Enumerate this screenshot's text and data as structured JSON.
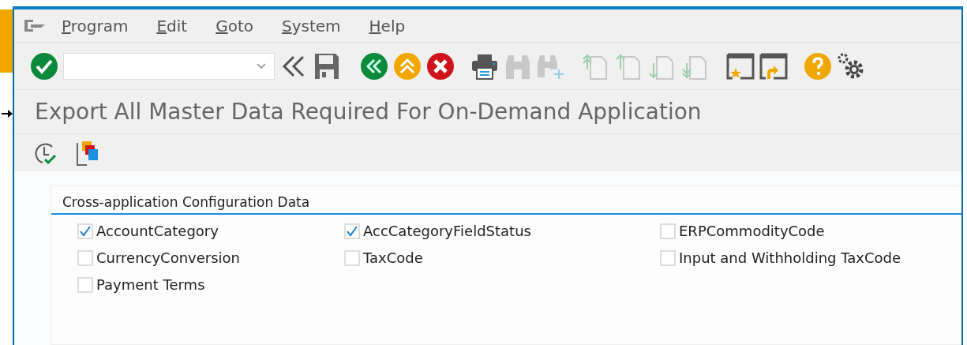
{
  "menu": [
    {
      "label": "Program"
    },
    {
      "label": "Edit"
    },
    {
      "label": "Goto"
    },
    {
      "label": "System"
    },
    {
      "label": "Help"
    }
  ],
  "toolbar": [
    {
      "kind": "enter",
      "disabled": false
    },
    {
      "kind": "command-field",
      "disabled": false
    },
    {
      "kind": "collapse",
      "disabled": false
    },
    {
      "kind": "save",
      "disabled": false
    },
    {
      "kind": "back",
      "disabled": false
    },
    {
      "kind": "exit",
      "disabled": false
    },
    {
      "kind": "cancel",
      "disabled": false
    },
    {
      "kind": "print",
      "disabled": false
    },
    {
      "kind": "find",
      "disabled": true
    },
    {
      "kind": "find-next",
      "disabled": true
    },
    {
      "kind": "first-page",
      "disabled": true
    },
    {
      "kind": "previous-page",
      "disabled": true
    },
    {
      "kind": "next-page",
      "disabled": true
    },
    {
      "kind": "last-page",
      "disabled": true
    },
    {
      "kind": "new-session",
      "disabled": false
    },
    {
      "kind": "shortcut",
      "disabled": false
    },
    {
      "kind": "help",
      "disabled": false
    },
    {
      "kind": "settings",
      "disabled": false
    }
  ],
  "title": "Export All Master Data Required For On-Demand Application",
  "group": {
    "title": "Cross-application Configuration Data",
    "items": [
      {
        "label": "AccountCategory",
        "checked": true
      },
      {
        "label": "AccCategoryFieldStatus",
        "checked": true
      },
      {
        "label": "ERPCommodityCode",
        "checked": false
      },
      {
        "label": "CurrencyConversion",
        "checked": false
      },
      {
        "label": "TaxCode",
        "checked": false
      },
      {
        "label": "Input and Withholding TaxCode",
        "checked": false
      },
      {
        "label": "Payment Terms",
        "checked": false
      }
    ]
  }
}
